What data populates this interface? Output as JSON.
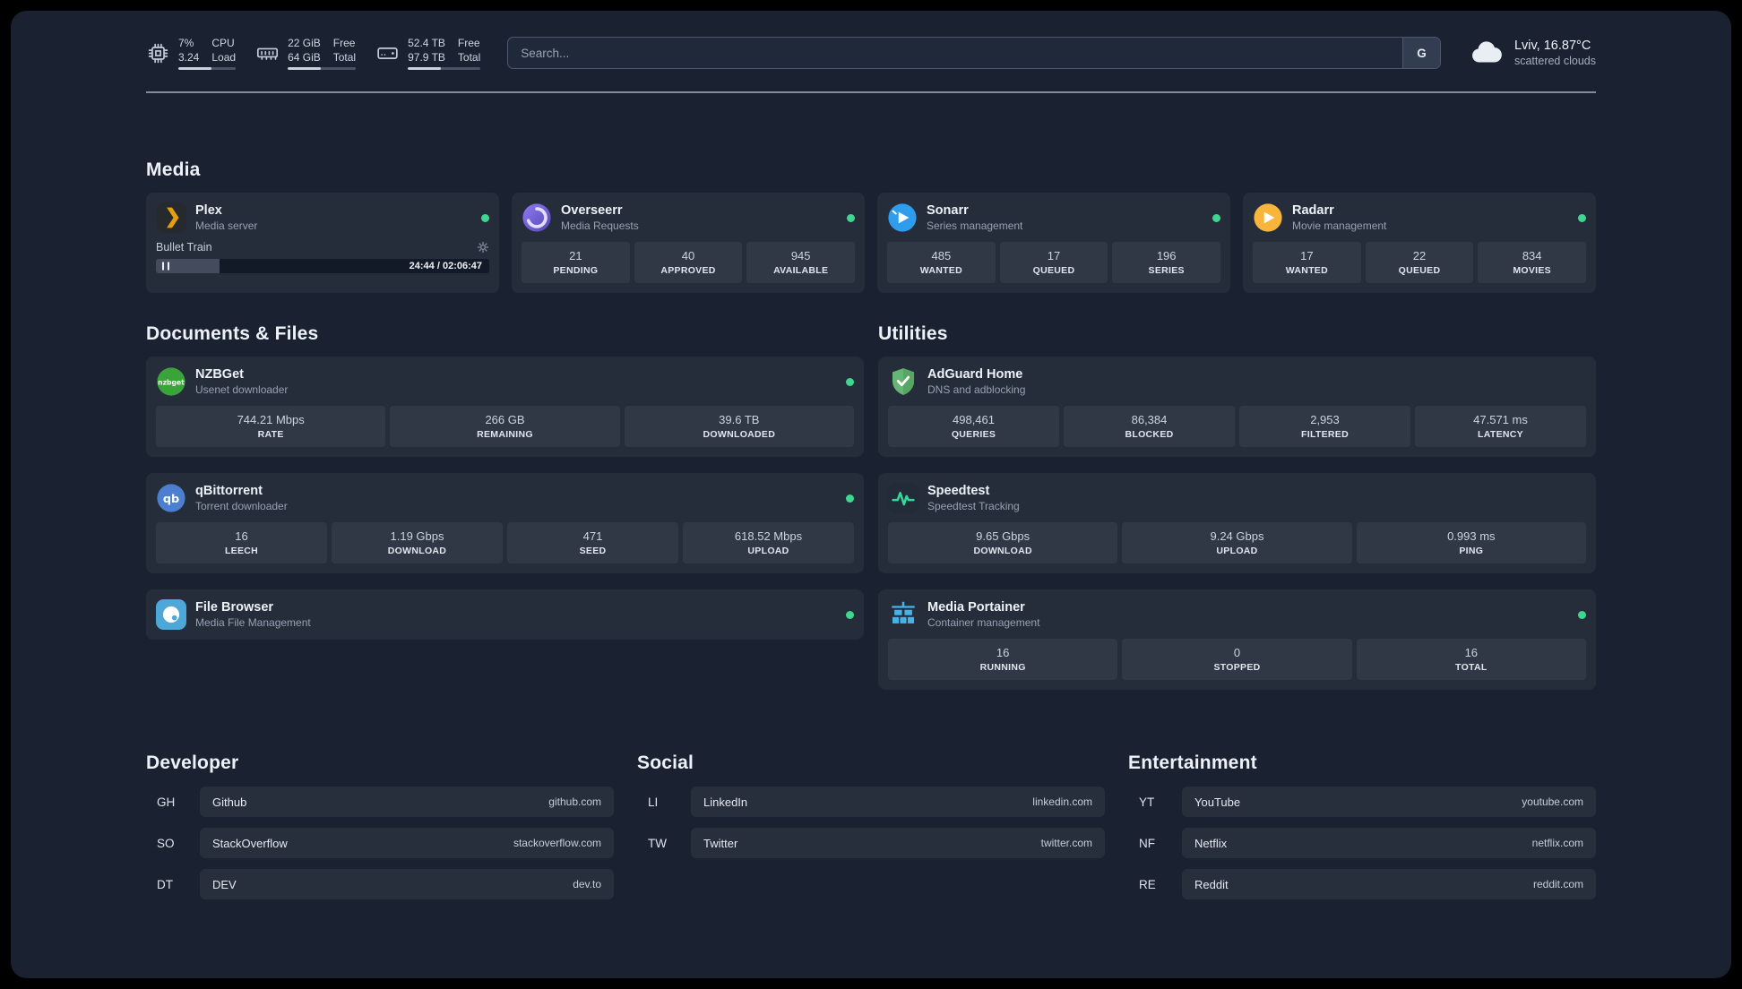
{
  "colors": {
    "background": "#1a2231",
    "card": "rgba(255,255,255,0.05)",
    "status_online": "#3fd68f",
    "accent_plex": "#e5a00d",
    "accent_overseerr": "#7b61d9",
    "accent_sonarr": "#2f9ced",
    "accent_radarr": "#f7b53c",
    "accent_nzbget": "#3aa33a",
    "accent_qbittorrent": "#4c7fd0",
    "accent_filebrowser": "#4da7d8",
    "accent_adguard": "#66b574",
    "accent_speedtest": "#37d69b",
    "accent_portainer": "#45b2e8"
  },
  "icons": {
    "cpu": "cpu-chip",
    "memory": "ram-stick",
    "disk": "hard-drive",
    "weather": "cloud",
    "plex": "chevron-badge",
    "overseerr": "swirl-circle",
    "sonarr": "play-circle-blue",
    "radarr": "play-circle-amber",
    "nzbget": "nzbget-badge",
    "qbittorrent": "qb-circle",
    "filebrowser": "disk-circle",
    "adguard": "shield-check",
    "speedtest": "pulse-line",
    "portainer": "container-crane",
    "player": "pause-and-gear"
  },
  "topbar": {
    "cpu": {
      "value": "7%",
      "sub": "3.24",
      "label1": "CPU",
      "label2": "Load",
      "bar_percent": 58
    },
    "memory": {
      "value": "22 GiB",
      "sub": "64 GiB",
      "label1": "Free",
      "label2": "Total",
      "bar_percent": 48
    },
    "disk": {
      "value": "52.4 TB",
      "sub": "97.9 TB",
      "label1": "Free",
      "label2": "Total",
      "bar_percent": 45
    },
    "search": {
      "placeholder": "Search...",
      "button_label": "G"
    },
    "weather": {
      "location": "Lviv, 16.87°C",
      "condition": "scattered clouds"
    }
  },
  "groups": {
    "media": {
      "title": "Media",
      "plex": {
        "name": "Plex",
        "desc": "Media server",
        "now_playing": "Bullet Train",
        "time": "24:44 / 02:06:47",
        "progress_percent": 19
      },
      "overseerr": {
        "name": "Overseerr",
        "desc": "Media Requests",
        "stats": [
          {
            "value": "21",
            "label": "PENDING"
          },
          {
            "value": "40",
            "label": "APPROVED"
          },
          {
            "value": "945",
            "label": "AVAILABLE"
          }
        ]
      },
      "sonarr": {
        "name": "Sonarr",
        "desc": "Series management",
        "stats": [
          {
            "value": "485",
            "label": "WANTED"
          },
          {
            "value": "17",
            "label": "QUEUED"
          },
          {
            "value": "196",
            "label": "SERIES"
          }
        ]
      },
      "radarr": {
        "name": "Radarr",
        "desc": "Movie management",
        "stats": [
          {
            "value": "17",
            "label": "WANTED"
          },
          {
            "value": "22",
            "label": "QUEUED"
          },
          {
            "value": "834",
            "label": "MOVIES"
          }
        ]
      }
    },
    "documents": {
      "title": "Documents & Files",
      "nzbget": {
        "name": "NZBGet",
        "desc": "Usenet downloader",
        "stats": [
          {
            "value": "744.21 Mbps",
            "label": "RATE"
          },
          {
            "value": "266 GB",
            "label": "REMAINING"
          },
          {
            "value": "39.6 TB",
            "label": "DOWNLOADED"
          }
        ]
      },
      "qbittorrent": {
        "name": "qBittorrent",
        "desc": "Torrent downloader",
        "stats": [
          {
            "value": "16",
            "label": "LEECH"
          },
          {
            "value": "1.19 Gbps",
            "label": "DOWNLOAD"
          },
          {
            "value": "471",
            "label": "SEED"
          },
          {
            "value": "618.52 Mbps",
            "label": "UPLOAD"
          }
        ]
      },
      "filebrowser": {
        "name": "File Browser",
        "desc": "Media File Management"
      }
    },
    "utilities": {
      "title": "Utilities",
      "adguard": {
        "name": "AdGuard Home",
        "desc": "DNS and adblocking",
        "stats": [
          {
            "value": "498,461",
            "label": "QUERIES"
          },
          {
            "value": "86,384",
            "label": "BLOCKED"
          },
          {
            "value": "2,953",
            "label": "FILTERED"
          },
          {
            "value": "47.571 ms",
            "label": "LATENCY"
          }
        ]
      },
      "speedtest": {
        "name": "Speedtest",
        "desc": "Speedtest Tracking",
        "stats": [
          {
            "value": "9.65 Gbps",
            "label": "DOWNLOAD"
          },
          {
            "value": "9.24 Gbps",
            "label": "UPLOAD"
          },
          {
            "value": "0.993 ms",
            "label": "PING"
          }
        ]
      },
      "portainer": {
        "name": "Media Portainer",
        "desc": "Container management",
        "stats": [
          {
            "value": "16",
            "label": "RUNNING"
          },
          {
            "value": "0",
            "label": "STOPPED"
          },
          {
            "value": "16",
            "label": "TOTAL"
          }
        ]
      }
    }
  },
  "bookmarks": {
    "developer": {
      "title": "Developer",
      "items": [
        {
          "abbr": "GH",
          "name": "Github",
          "url": "github.com"
        },
        {
          "abbr": "SO",
          "name": "StackOverflow",
          "url": "stackoverflow.com"
        },
        {
          "abbr": "DT",
          "name": "DEV",
          "url": "dev.to"
        }
      ]
    },
    "social": {
      "title": "Social",
      "items": [
        {
          "abbr": "LI",
          "name": "LinkedIn",
          "url": "linkedin.com"
        },
        {
          "abbr": "TW",
          "name": "Twitter",
          "url": "twitter.com"
        }
      ]
    },
    "entertainment": {
      "title": "Entertainment",
      "items": [
        {
          "abbr": "YT",
          "name": "YouTube",
          "url": "youtube.com"
        },
        {
          "abbr": "NF",
          "name": "Netflix",
          "url": "netflix.com"
        },
        {
          "abbr": "RE",
          "name": "Reddit",
          "url": "reddit.com"
        }
      ]
    }
  }
}
